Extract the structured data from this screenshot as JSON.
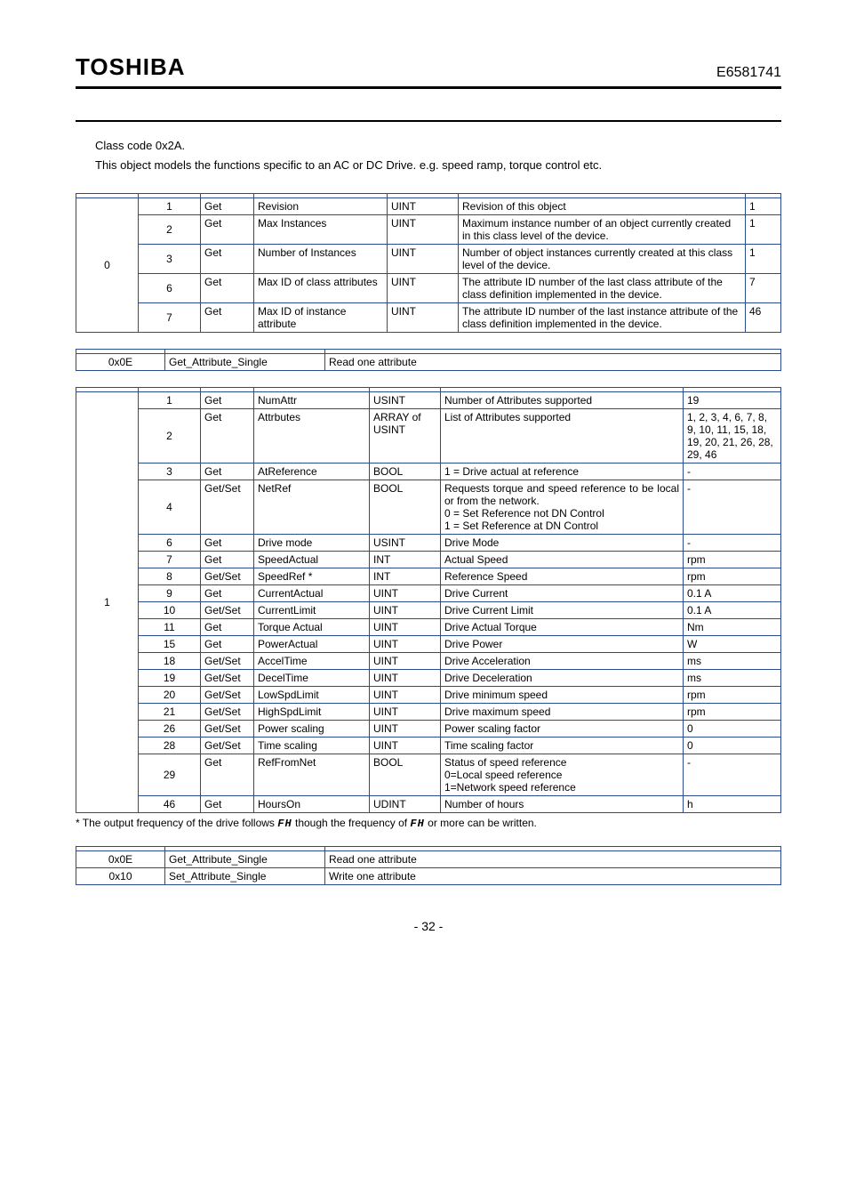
{
  "header": {
    "logo": "TOSHIBA",
    "docnum": "E6581741"
  },
  "intro": {
    "line1": "Class code 0x2A.",
    "line2": "This object models the functions specific to an AC or DC Drive. e.g. speed ramp, torque control etc."
  },
  "class_attrs": {
    "instance": "0",
    "rows": [
      {
        "id": "1",
        "acc": "Get",
        "name": "Revision",
        "type": "UINT",
        "desc": "Revision of this object",
        "def": "1"
      },
      {
        "id": "2",
        "acc": "Get",
        "name": "Max Instances",
        "type": "UINT",
        "desc": "Maximum instance number of an object currently created in this class level of the device.",
        "def": "1"
      },
      {
        "id": "3",
        "acc": "Get",
        "name": "Number of Instances",
        "type": "UINT",
        "desc": "Number of object instances currently created at this class level of the device.",
        "def": "1"
      },
      {
        "id": "6",
        "acc": "Get",
        "name": "Max ID of class attributes",
        "type": "UINT",
        "desc": "The attribute ID number of the last class attribute of the class definition implemented in the device.",
        "def": "7"
      },
      {
        "id": "7",
        "acc": "Get",
        "name": "Max ID of instance attribute",
        "type": "UINT",
        "desc": "The attribute ID number of the last instance attribute of the class definition implemented in the device.",
        "def": "46"
      }
    ]
  },
  "class_svc": {
    "rows": [
      {
        "code": "0x0E",
        "name": "Get_Attribute_Single",
        "desc": "Read one attribute"
      }
    ]
  },
  "inst_attrs": {
    "instance": "1",
    "rows": [
      {
        "id": "1",
        "acc": "Get",
        "name": "NumAttr",
        "type": "USINT",
        "desc": "Number of Attributes supported",
        "def": "19"
      },
      {
        "id": "2",
        "acc": "Get",
        "name": "Attrbutes",
        "type": "ARRAY of USINT",
        "desc": "List of Attributes supported",
        "def": "1, 2, 3, 4, 6, 7, 8, 9, 10, 11, 15, 18, 19, 20, 21, 26, 28, 29, 46"
      },
      {
        "id": "3",
        "acc": "Get",
        "name": "AtReference",
        "type": "BOOL",
        "desc": "1 = Drive actual at reference",
        "def": "-"
      },
      {
        "id": "4",
        "acc": "Get/Set",
        "name": "NetRef",
        "type": "BOOL",
        "desc": "Requests torque and speed reference to be local or from the network.\n0 = Set Reference not DN Control\n1 = Set Reference at DN Control",
        "def": "-"
      },
      {
        "id": "6",
        "acc": "Get",
        "name": "Drive mode",
        "type": "USINT",
        "desc": "Drive Mode",
        "def": "-"
      },
      {
        "id": "7",
        "acc": "Get",
        "name": "SpeedActual",
        "type": "INT",
        "desc": "Actual Speed",
        "def": "rpm"
      },
      {
        "id": "8",
        "acc": "Get/Set",
        "name": "SpeedRef *",
        "type": "INT",
        "desc": "Reference Speed",
        "def": "rpm"
      },
      {
        "id": "9",
        "acc": "Get",
        "name": "CurrentActual",
        "type": "UINT",
        "desc": "Drive Current",
        "def": "0.1 A"
      },
      {
        "id": "10",
        "acc": "Get/Set",
        "name": "CurrentLimit",
        "type": "UINT",
        "desc": "Drive Current Limit",
        "def": "0.1 A"
      },
      {
        "id": "11",
        "acc": "Get",
        "name": "Torque Actual",
        "type": "UINT",
        "desc": "Drive Actual Torque",
        "def": "Nm"
      },
      {
        "id": "15",
        "acc": "Get",
        "name": "PowerActual",
        "type": "UINT",
        "desc": "Drive Power",
        "def": "W"
      },
      {
        "id": "18",
        "acc": "Get/Set",
        "name": "AccelTime",
        "type": "UINT",
        "desc": "Drive Acceleration",
        "def": "ms"
      },
      {
        "id": "19",
        "acc": "Get/Set",
        "name": "DecelTime",
        "type": "UINT",
        "desc": "Drive Deceleration",
        "def": "ms"
      },
      {
        "id": "20",
        "acc": "Get/Set",
        "name": "LowSpdLimit",
        "type": "UINT",
        "desc": "Drive minimum speed",
        "def": "rpm"
      },
      {
        "id": "21",
        "acc": "Get/Set",
        "name": "HighSpdLimit",
        "type": "UINT",
        "desc": "Drive maximum speed",
        "def": "rpm"
      },
      {
        "id": "26",
        "acc": "Get/Set",
        "name": "Power scaling",
        "type": "UINT",
        "desc": "Power scaling factor",
        "def": "0"
      },
      {
        "id": "28",
        "acc": "Get/Set",
        "name": "Time scaling",
        "type": "UINT",
        "desc": "Time scaling factor",
        "def": "0"
      },
      {
        "id": "29",
        "acc": "Get",
        "name": "RefFromNet",
        "type": "BOOL",
        "desc": "Status of speed reference\n0=Local speed reference\n1=Network speed reference",
        "def": "-"
      },
      {
        "id": "46",
        "acc": "Get",
        "name": "HoursOn",
        "type": "UDINT",
        "desc": "Number of hours",
        "def": "h"
      }
    ]
  },
  "footnote": {
    "prefix": "* The output frequency of the drive follows ",
    "code1": "FH",
    "mid": " though the frequency of ",
    "code2": "FH",
    "suffix": " or more can be written."
  },
  "inst_svc": {
    "rows": [
      {
        "code": "0x0E",
        "name": "Get_Attribute_Single",
        "desc": "Read one attribute"
      },
      {
        "code": "0x10",
        "name": "Set_Attribute_Single",
        "desc": "Write one attribute"
      }
    ]
  },
  "page": "- 32 -"
}
